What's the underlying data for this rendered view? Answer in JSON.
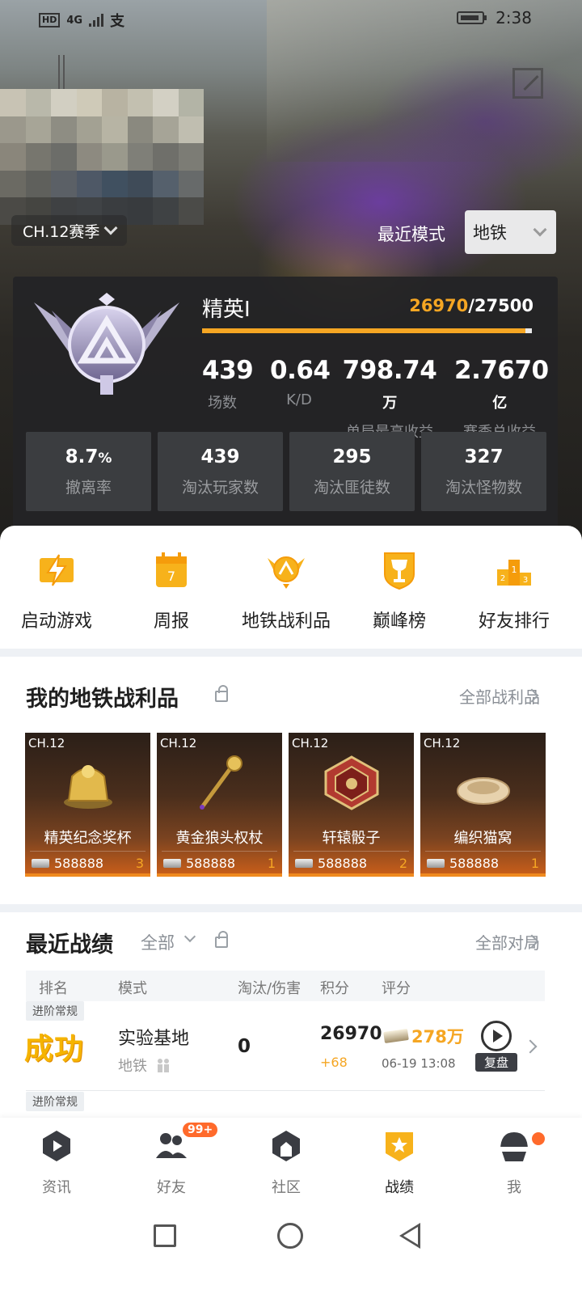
{
  "status_bar": {
    "hd": "HD",
    "network": "4G",
    "time": "2:38"
  },
  "header": {
    "season": "CH.12赛季",
    "recent_mode_label": "最近模式",
    "mode_value": "地铁"
  },
  "rank": {
    "name": "精英I",
    "current": "26970",
    "target": "/27500",
    "progress": 0.981
  },
  "main_stats": [
    {
      "value": "439",
      "unit": "",
      "label": "场数"
    },
    {
      "value": "0.64",
      "unit": "",
      "label": "K/D"
    },
    {
      "value": "798.74",
      "unit": "万",
      "label": "单局最高收益"
    },
    {
      "value": "2.7670",
      "unit": "亿",
      "label": "赛季总收益"
    }
  ],
  "sub_stats": [
    {
      "value": "8.7",
      "unit": "%",
      "label": "撤离率"
    },
    {
      "value": "439",
      "unit": "",
      "label": "淘汰玩家数"
    },
    {
      "value": "295",
      "unit": "",
      "label": "淘汰匪徒数"
    },
    {
      "value": "327",
      "unit": "",
      "label": "淘汰怪物数"
    }
  ],
  "quick_actions": [
    {
      "label": "启动游戏",
      "icon": "lightning-icon"
    },
    {
      "label": "周报",
      "icon": "calendar-icon",
      "badge": "7"
    },
    {
      "label": "地铁战利品",
      "icon": "shield-badge-icon"
    },
    {
      "label": "巅峰榜",
      "icon": "trophy-shield-icon"
    },
    {
      "label": "好友排行",
      "icon": "podium-icon"
    }
  ],
  "loot": {
    "title": "我的地铁战利品",
    "more": "全部战利品",
    "items": [
      {
        "chapter": "CH.12",
        "name": "精英纪念奖杯",
        "price": "588888",
        "count": "3"
      },
      {
        "chapter": "CH.12",
        "name": "黄金狼头权杖",
        "price": "588888",
        "count": "1"
      },
      {
        "chapter": "CH.12",
        "name": "轩辕骰子",
        "price": "588888",
        "count": "2"
      },
      {
        "chapter": "CH.12",
        "name": "编织猫窝",
        "price": "588888",
        "count": "1"
      }
    ]
  },
  "battles": {
    "title": "最近战绩",
    "filter": "全部",
    "more": "全部对局",
    "columns": [
      "排名",
      "模式",
      "淘汰/伤害",
      "积分",
      "评分"
    ],
    "rows": [
      {
        "tag": "进阶常规",
        "result": "成功",
        "map": "实验基地",
        "mode": "地铁",
        "kills": "0",
        "score": "26970",
        "delta": "+68",
        "earnings": "278万",
        "time": "06-19 13:08",
        "replay": "复盘"
      },
      {
        "tag": "进阶常规"
      }
    ]
  },
  "bottom_nav": [
    {
      "label": "资讯",
      "icon": "news-icon"
    },
    {
      "label": "好友",
      "icon": "friends-icon",
      "badge": "99+"
    },
    {
      "label": "社区",
      "icon": "community-icon"
    },
    {
      "label": "战绩",
      "icon": "record-icon",
      "active": true
    },
    {
      "label": "我",
      "icon": "profile-icon"
    }
  ],
  "colors": {
    "accent": "#f5a623",
    "card_bg": "#232426",
    "loot_bottom": "#f08a1f",
    "badge": "#ff6a2b"
  }
}
